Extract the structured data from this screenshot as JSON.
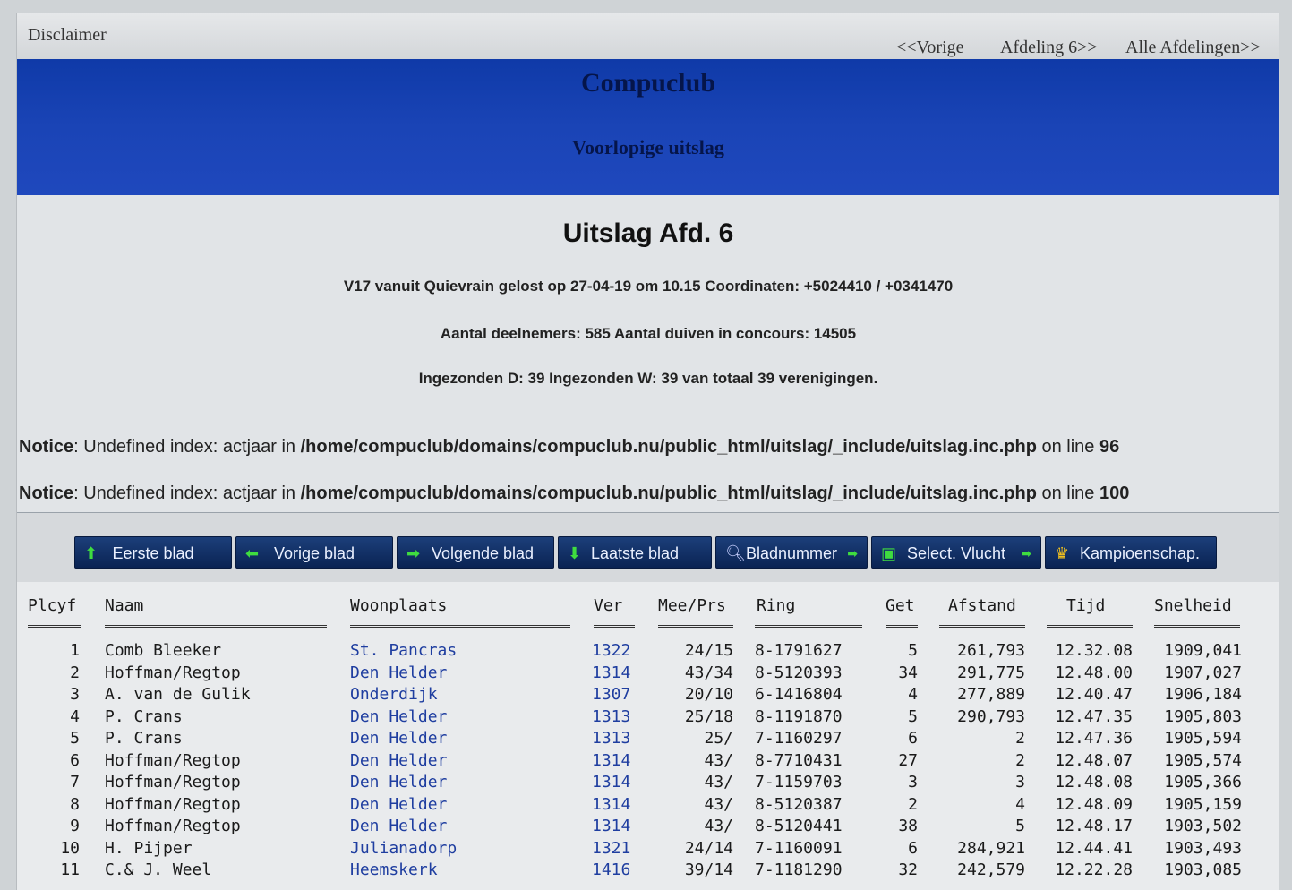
{
  "topbar": {
    "disclaimer": "Disclaimer",
    "prev": "<<Vorige",
    "next": "Afdeling 6>>",
    "all": "Alle Afdelingen>>"
  },
  "header": {
    "club": "Compuclub",
    "subtitle": "Voorlopige uitslag"
  },
  "info": {
    "title": "Uitslag Afd. 6",
    "line1": "V17 vanuit Quievrain gelost op 27-04-19 om 10.15 Coordinaten: +5024410 / +0341470",
    "line2": "Aantal deelnemers: 585 Aantal duiven in concours: 14505",
    "line3": "Ingezonden D: 39 Ingezonden W: 39 van totaal 39 verenigingen."
  },
  "notices": [
    {
      "label": "Notice",
      "text": ": Undefined index: actjaar in ",
      "path": "/home/compuclub/domains/compuclub.nu/public_html/uitslag/_include/uitslag.inc.php",
      "online": " on line ",
      "line": "96"
    },
    {
      "label": "Notice",
      "text": ": Undefined index: actjaar in ",
      "path": "/home/compuclub/domains/compuclub.nu/public_html/uitslag/_include/uitslag.inc.php",
      "online": " on line ",
      "line": "100"
    }
  ],
  "toolbar": {
    "first": "Eerste blad",
    "prev": "Vorige blad",
    "next": "Volgende blad",
    "last": "Laatste blad",
    "page": "Bladnummer",
    "select": "Select. Vlucht",
    "champ": "Kampioenschap."
  },
  "table": {
    "headers": [
      "Plcyf",
      "Naam",
      "Woonplaats",
      "Ver",
      "Mee/Prs",
      "Ring",
      "Get",
      "Afstand",
      "Tijd",
      "Snelheid"
    ],
    "rows": [
      [
        "1",
        "Comb Bleeker",
        "St. Pancras",
        "1322",
        "24/15",
        "8-1791627",
        "5",
        "261,793",
        "12.32.08",
        "1909,041"
      ],
      [
        "2",
        "Hoffman/Regtop",
        "Den Helder",
        "1314",
        "43/34",
        "8-5120393",
        "34",
        "291,775",
        "12.48.00",
        "1907,027"
      ],
      [
        "3",
        "A. van de Gulik",
        "Onderdijk",
        "1307",
        "20/10",
        "6-1416804",
        "4",
        "277,889",
        "12.40.47",
        "1906,184"
      ],
      [
        "4",
        "P. Crans",
        "Den Helder",
        "1313",
        "25/18",
        "8-1191870",
        "5",
        "290,793",
        "12.47.35",
        "1905,803"
      ],
      [
        "5",
        "P. Crans",
        "Den Helder",
        "1313",
        "25/",
        "7-1160297",
        "6",
        "2",
        "12.47.36",
        "1905,594"
      ],
      [
        "6",
        "Hoffman/Regtop",
        "Den Helder",
        "1314",
        "43/",
        "8-7710431",
        "27",
        "2",
        "12.48.07",
        "1905,574"
      ],
      [
        "7",
        "Hoffman/Regtop",
        "Den Helder",
        "1314",
        "43/",
        "7-1159703",
        "3",
        "3",
        "12.48.08",
        "1905,366"
      ],
      [
        "8",
        "Hoffman/Regtop",
        "Den Helder",
        "1314",
        "43/",
        "8-5120387",
        "2",
        "4",
        "12.48.09",
        "1905,159"
      ],
      [
        "9",
        "Hoffman/Regtop",
        "Den Helder",
        "1314",
        "43/",
        "8-5120441",
        "38",
        "5",
        "12.48.17",
        "1903,502"
      ],
      [
        "10",
        "H. Pijper",
        "Julianadorp",
        "1321",
        "24/14",
        "7-1160091",
        "6",
        "284,921",
        "12.44.41",
        "1903,493"
      ],
      [
        "11",
        "C.& J. Weel",
        "Heemskerk",
        "1416",
        "39/14",
        "7-1181290",
        "32",
        "242,579",
        "12.22.28",
        "1903,085"
      ]
    ]
  }
}
